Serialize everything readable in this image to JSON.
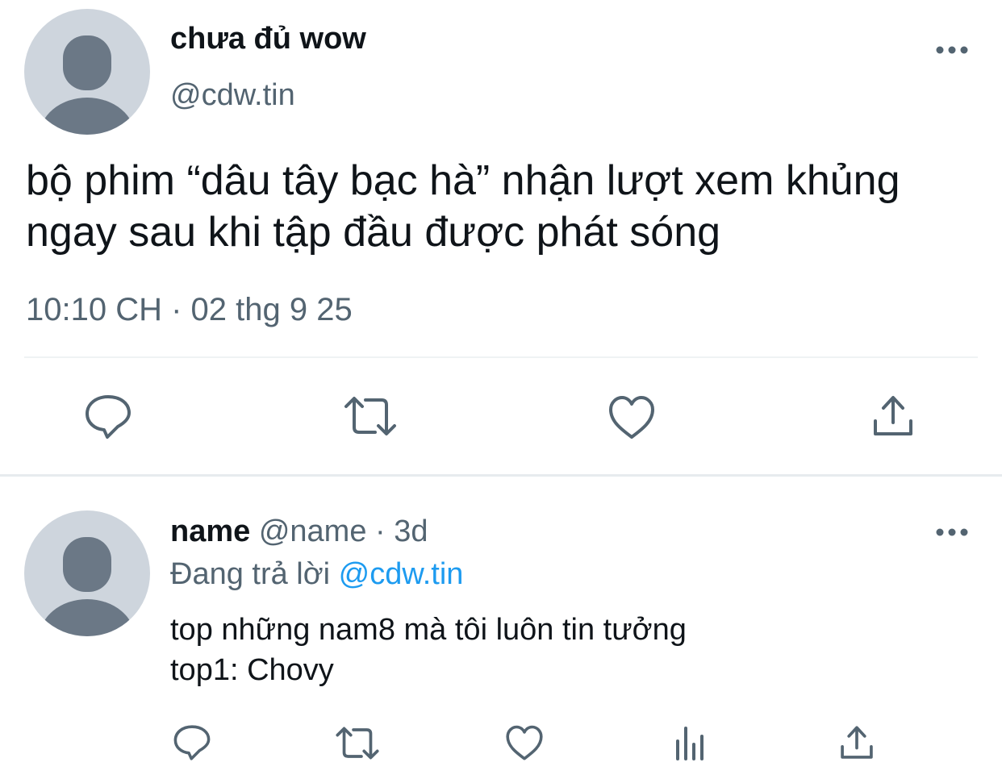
{
  "main_tweet": {
    "display_name": "chưa đủ wow",
    "handle": "@cdw.tin",
    "text_lines": [
      "bộ phim “dâu tây bạc hà” nhận lượt xem khủng",
      "ngay sau khi tập đầu được phát sóng"
    ],
    "timestamp": "10:10 CH · 02 thg 9 25",
    "avatar_icon": "default-avatar-icon",
    "more_icon": "more-icon",
    "actions": [
      "reply-icon",
      "retweet-icon",
      "like-icon",
      "share-icon"
    ]
  },
  "reply": {
    "display_name": "name",
    "handle": "@name",
    "separator": "·",
    "time": "3d",
    "replying_to_label": "Đang trả lời",
    "replying_to_handle": "@cdw.tin",
    "text_lines": [
      "top những nam8 mà tôi luôn tin tưởng",
      "top1: Chovy"
    ],
    "avatar_icon": "default-avatar-icon",
    "more_icon": "more-icon",
    "actions": [
      "reply-icon",
      "retweet-icon",
      "like-icon",
      "analytics-icon",
      "share-icon"
    ]
  },
  "colors": {
    "text_primary": "#0f1419",
    "text_secondary": "#536471",
    "link": "#1d9bf0",
    "avatar_bg": "#ced5dd",
    "avatar_fg": "#6b7886",
    "divider": "#eff3f4"
  }
}
